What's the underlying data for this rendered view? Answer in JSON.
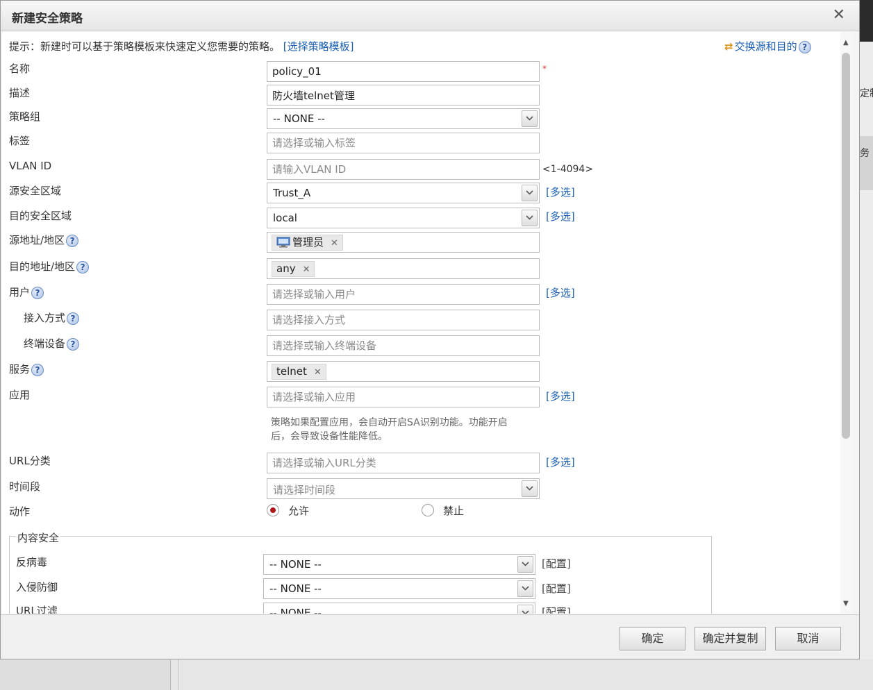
{
  "dialog": {
    "title": "新建安全策略",
    "close_icon": "✕"
  },
  "hint": {
    "text": "提示：新建时可以基于策略模板来快速定义您需要的策略。",
    "template_link": "[选择策略模板]"
  },
  "swap": {
    "label": "交换源和目的",
    "icon": "swap-arrows-icon"
  },
  "help_glyph": "?",
  "form": {
    "name": {
      "label": "名称",
      "value": "policy_01",
      "required_mark": "*"
    },
    "description": {
      "label": "描述",
      "value": "防火墙telnet管理"
    },
    "policy_group": {
      "label": "策略组",
      "value": "-- NONE --"
    },
    "tag": {
      "label": "标签",
      "placeholder": "请选择或输入标签"
    },
    "vlan": {
      "label": "VLAN ID",
      "placeholder": "请输入VLAN ID",
      "range": "<1-4094>"
    },
    "src_zone": {
      "label": "源安全区域",
      "value": "Trust_A",
      "multi": "[多选]"
    },
    "dst_zone": {
      "label": "目的安全区域",
      "value": "local",
      "multi": "[多选]"
    },
    "src_addr": {
      "label": "源地址/地区",
      "tag": "管理员"
    },
    "dst_addr": {
      "label": "目的地址/地区",
      "tag": "any"
    },
    "user": {
      "label": "用户",
      "placeholder": "请选择或输入用户",
      "multi": "[多选]"
    },
    "access_mode": {
      "label": "接入方式",
      "placeholder": "请选择接入方式"
    },
    "terminal": {
      "label": "终端设备",
      "placeholder": "请选择或输入终端设备"
    },
    "service": {
      "label": "服务",
      "tag": "telnet"
    },
    "application": {
      "label": "应用",
      "placeholder": "请选择或输入应用",
      "multi": "[多选]",
      "note_line1": "策略如果配置应用，会自动开启SA识别功能。功能开启",
      "note_line2": "后，会导致设备性能降低。"
    },
    "url_category": {
      "label": "URL分类",
      "placeholder": "请选择或输入URL分类",
      "multi": "[多选]"
    },
    "time_range": {
      "label": "时间段",
      "placeholder": "请选择时间段"
    },
    "action": {
      "label": "动作",
      "allow": "允许",
      "deny": "禁止",
      "selected": "允许"
    }
  },
  "content_security": {
    "legend": "内容安全",
    "antivirus": {
      "label": "反病毒",
      "value": "-- NONE --",
      "config": "[配置]"
    },
    "ips": {
      "label": "入侵防御",
      "value": "-- NONE --",
      "config": "[配置]"
    },
    "url_filter": {
      "label": "URL过滤",
      "value": "-- NONE --",
      "config": "[配置]"
    }
  },
  "buttons": {
    "ok": "确定",
    "ok_copy": "确定并复制",
    "cancel": "取消"
  },
  "background": {
    "frag1": "定制",
    "frag2": "务"
  },
  "colors": {
    "link": "#1a5fb4",
    "required": "#d33333",
    "radio_selected": "#b3161a"
  }
}
